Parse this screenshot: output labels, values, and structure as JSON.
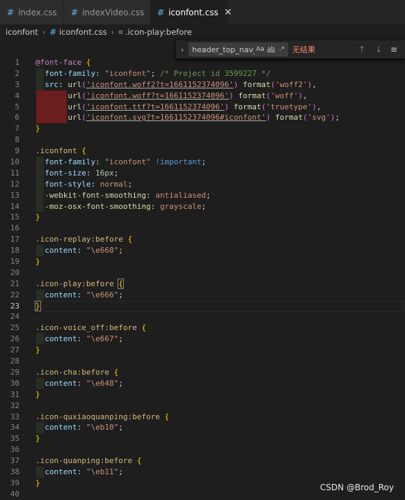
{
  "tabs": [
    {
      "name": "index.css",
      "active": false
    },
    {
      "name": "indexVideo.css",
      "active": false
    },
    {
      "name": "iconfont.css",
      "active": true
    }
  ],
  "tab_close_glyph": "✕",
  "breadcrumb": {
    "folder": "iconfont",
    "file": "iconfont.css",
    "symbol": ".icon-play:before"
  },
  "find": {
    "query": "header_top_nav_ri",
    "match_case": "Aa",
    "whole_word": "ab",
    "regex": ".*",
    "result": "无结果"
  },
  "watermark": "CSDN @Brod_Roy",
  "colors": {
    "accent": "#007acc",
    "background": "#1e1e1e",
    "no_result": "#f48771"
  },
  "lines": [
    {
      "n": "1",
      "tokens": [
        [
          "k-at",
          "@font-face"
        ],
        [
          "k-pun",
          " "
        ],
        [
          "k-brace",
          "{"
        ]
      ]
    },
    {
      "n": "2",
      "guide": true,
      "tokens": [
        [
          "k-pun",
          "  "
        ],
        [
          "k-prop",
          "font-family"
        ],
        [
          "k-pun",
          ": "
        ],
        [
          "k-str",
          "\"iconfont\""
        ],
        [
          "k-pun",
          "; "
        ],
        [
          "k-com",
          "/* Project id 3599227 */"
        ]
      ]
    },
    {
      "n": "3",
      "guide": true,
      "tokens": [
        [
          "k-pun",
          "  "
        ],
        [
          "k-prop",
          "src"
        ],
        [
          "k-pun",
          ": "
        ],
        [
          "k-fn",
          "url"
        ],
        [
          "k-paren",
          "("
        ],
        [
          "k-url",
          "'iconfont.woff2?t=1661152374096'"
        ],
        [
          "k-paren",
          ")"
        ],
        [
          "k-pun",
          " "
        ],
        [
          "k-fn",
          "format"
        ],
        [
          "k-paren",
          "("
        ],
        [
          "k-kw",
          "'woff2'"
        ],
        [
          "k-paren",
          ")"
        ],
        [
          "k-pun",
          ","
        ]
      ]
    },
    {
      "n": "4",
      "guide": "red",
      "tokens": [
        [
          "k-pun",
          "       "
        ],
        [
          "k-fn",
          "url"
        ],
        [
          "k-paren",
          "("
        ],
        [
          "k-url",
          "'iconfont.woff?t=1661152374096'"
        ],
        [
          "k-paren",
          ")"
        ],
        [
          "k-pun",
          " "
        ],
        [
          "k-fn",
          "format"
        ],
        [
          "k-paren",
          "("
        ],
        [
          "k-kw",
          "'woff'"
        ],
        [
          "k-paren",
          ")"
        ],
        [
          "k-pun",
          ","
        ]
      ]
    },
    {
      "n": "5",
      "guide": "red",
      "tokens": [
        [
          "k-pun",
          "       "
        ],
        [
          "k-fn",
          "url"
        ],
        [
          "k-paren",
          "("
        ],
        [
          "k-url",
          "'iconfont.ttf?t=1661152374096'"
        ],
        [
          "k-paren",
          ")"
        ],
        [
          "k-pun",
          " "
        ],
        [
          "k-fn",
          "format"
        ],
        [
          "k-paren",
          "("
        ],
        [
          "k-kw",
          "'truetype'"
        ],
        [
          "k-paren",
          ")"
        ],
        [
          "k-pun",
          ","
        ]
      ]
    },
    {
      "n": "6",
      "guide": "red",
      "tokens": [
        [
          "k-pun",
          "       "
        ],
        [
          "k-fn",
          "url"
        ],
        [
          "k-paren",
          "("
        ],
        [
          "k-url",
          "'iconfont.svg?t=1661152374096#iconfont'"
        ],
        [
          "k-paren",
          ")"
        ],
        [
          "k-pun",
          " "
        ],
        [
          "k-fn",
          "format"
        ],
        [
          "k-paren",
          "("
        ],
        [
          "k-kw",
          "'svg'"
        ],
        [
          "k-paren",
          ")"
        ],
        [
          "k-pun",
          ";"
        ]
      ]
    },
    {
      "n": "7",
      "tokens": [
        [
          "k-brace",
          "}"
        ]
      ]
    },
    {
      "n": "8",
      "tokens": []
    },
    {
      "n": "9",
      "tokens": [
        [
          "k-sel",
          ".iconfont"
        ],
        [
          "k-pun",
          " "
        ],
        [
          "k-brace",
          "{"
        ]
      ]
    },
    {
      "n": "10",
      "guide": true,
      "tokens": [
        [
          "k-pun",
          "  "
        ],
        [
          "k-prop",
          "font-family"
        ],
        [
          "k-pun",
          ": "
        ],
        [
          "k-str",
          "\"iconfont\""
        ],
        [
          "k-pun",
          " "
        ],
        [
          "k-imp",
          "!important"
        ],
        [
          "k-pun",
          ";"
        ]
      ]
    },
    {
      "n": "11",
      "guide": true,
      "tokens": [
        [
          "k-pun",
          "  "
        ],
        [
          "k-prop",
          "font-size"
        ],
        [
          "k-pun",
          ": "
        ],
        [
          "k-num",
          "16px"
        ],
        [
          "k-pun",
          ";"
        ]
      ]
    },
    {
      "n": "12",
      "guide": true,
      "tokens": [
        [
          "k-pun",
          "  "
        ],
        [
          "k-prop",
          "font-style"
        ],
        [
          "k-pun",
          ": "
        ],
        [
          "k-str",
          "normal"
        ],
        [
          "k-pun",
          ";"
        ]
      ]
    },
    {
      "n": "13",
      "guide": true,
      "tokens": [
        [
          "k-pun",
          "  "
        ],
        [
          "k-prop-y",
          "-webkit-font-smoothing"
        ],
        [
          "k-pun",
          ": "
        ],
        [
          "k-str",
          "antialiased"
        ],
        [
          "k-pun",
          ";"
        ]
      ]
    },
    {
      "n": "14",
      "guide": true,
      "tokens": [
        [
          "k-pun",
          "  "
        ],
        [
          "k-prop-y",
          "-moz-osx-font-smoothing"
        ],
        [
          "k-pun",
          ": "
        ],
        [
          "k-str",
          "grayscale"
        ],
        [
          "k-pun",
          ";"
        ]
      ]
    },
    {
      "n": "15",
      "tokens": [
        [
          "k-brace",
          "}"
        ]
      ]
    },
    {
      "n": "16",
      "tokens": []
    },
    {
      "n": "17",
      "tokens": [
        [
          "k-sel",
          ".icon-replay:before"
        ],
        [
          "k-pun",
          " "
        ],
        [
          "k-brace",
          "{"
        ]
      ]
    },
    {
      "n": "18",
      "guide": true,
      "tokens": [
        [
          "k-pun",
          "  "
        ],
        [
          "k-prop",
          "content"
        ],
        [
          "k-pun",
          ": "
        ],
        [
          "k-str",
          "\"\\e668\""
        ],
        [
          "k-pun",
          ";"
        ]
      ]
    },
    {
      "n": "19",
      "tokens": [
        [
          "k-brace",
          "}"
        ]
      ]
    },
    {
      "n": "20",
      "tokens": []
    },
    {
      "n": "21",
      "tokens": [
        [
          "k-sel",
          ".icon-play:before"
        ],
        [
          "k-pun",
          " "
        ],
        [
          "k-brace bm",
          "{"
        ]
      ]
    },
    {
      "n": "22",
      "guide": true,
      "tokens": [
        [
          "k-pun",
          "  "
        ],
        [
          "k-prop",
          "content"
        ],
        [
          "k-pun",
          ": "
        ],
        [
          "k-str",
          "\"\\e666\""
        ],
        [
          "k-pun",
          ";"
        ]
      ]
    },
    {
      "n": "23",
      "current": true,
      "tokens": [
        [
          "k-brace bm",
          "}"
        ]
      ]
    },
    {
      "n": "24",
      "tokens": []
    },
    {
      "n": "25",
      "tokens": [
        [
          "k-sel",
          ".icon-voice_off:before"
        ],
        [
          "k-pun",
          " "
        ],
        [
          "k-brace",
          "{"
        ]
      ]
    },
    {
      "n": "26",
      "guide": true,
      "tokens": [
        [
          "k-pun",
          "  "
        ],
        [
          "k-prop",
          "content"
        ],
        [
          "k-pun",
          ": "
        ],
        [
          "k-str",
          "\"\\e667\""
        ],
        [
          "k-pun",
          ";"
        ]
      ]
    },
    {
      "n": "27",
      "tokens": [
        [
          "k-brace",
          "}"
        ]
      ]
    },
    {
      "n": "28",
      "tokens": []
    },
    {
      "n": "29",
      "tokens": [
        [
          "k-sel",
          ".icon-cha:before"
        ],
        [
          "k-pun",
          " "
        ],
        [
          "k-brace",
          "{"
        ]
      ]
    },
    {
      "n": "30",
      "guide": true,
      "tokens": [
        [
          "k-pun",
          "  "
        ],
        [
          "k-prop",
          "content"
        ],
        [
          "k-pun",
          ": "
        ],
        [
          "k-str",
          "\"\\e648\""
        ],
        [
          "k-pun",
          ";"
        ]
      ]
    },
    {
      "n": "31",
      "tokens": [
        [
          "k-brace",
          "}"
        ]
      ]
    },
    {
      "n": "32",
      "tokens": []
    },
    {
      "n": "33",
      "tokens": [
        [
          "k-sel",
          ".icon-quxiaoquanping:before"
        ],
        [
          "k-pun",
          " "
        ],
        [
          "k-brace",
          "{"
        ]
      ]
    },
    {
      "n": "34",
      "guide": true,
      "tokens": [
        [
          "k-pun",
          "  "
        ],
        [
          "k-prop",
          "content"
        ],
        [
          "k-pun",
          ": "
        ],
        [
          "k-str",
          "\"\\eb10\""
        ],
        [
          "k-pun",
          ";"
        ]
      ]
    },
    {
      "n": "35",
      "tokens": [
        [
          "k-brace",
          "}"
        ]
      ]
    },
    {
      "n": "36",
      "tokens": []
    },
    {
      "n": "37",
      "tokens": [
        [
          "k-sel",
          ".icon-quanping:before"
        ],
        [
          "k-pun",
          " "
        ],
        [
          "k-brace",
          "{"
        ]
      ]
    },
    {
      "n": "38",
      "guide": true,
      "tokens": [
        [
          "k-pun",
          "  "
        ],
        [
          "k-prop",
          "content"
        ],
        [
          "k-pun",
          ": "
        ],
        [
          "k-str",
          "\"\\eb11\""
        ],
        [
          "k-pun",
          ";"
        ]
      ]
    },
    {
      "n": "39",
      "tokens": [
        [
          "k-brace",
          "}"
        ]
      ]
    },
    {
      "n": "40",
      "tokens": []
    }
  ]
}
